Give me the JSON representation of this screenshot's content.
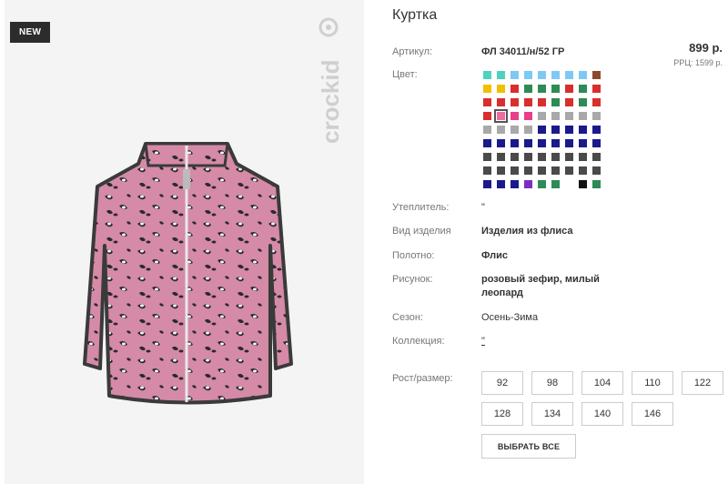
{
  "badge": "NEW",
  "brand": "crockid",
  "product": {
    "title": "Куртка",
    "price": "899 р.",
    "rrp": "РРЦ: 1599 р."
  },
  "labels": {
    "article": "Артикул:",
    "color": "Цвет:",
    "insulation": "Утеплитель:",
    "item_type": "Вид изделия",
    "fabric": "Полотно:",
    "print": "Рисунок:",
    "season": "Сезон:",
    "collection": "Коллекция:",
    "size": "Рост/размер:"
  },
  "values": {
    "article": "ФЛ 34011/н/52 ГР",
    "insulation": "\"",
    "item_type": "Изделия из флиса",
    "fabric": "Флис",
    "print_line1": "розовый зефир, милый",
    "print_line2": "леопард",
    "season": "Осень-Зима",
    "collection": "\""
  },
  "swatches": [
    [
      "#4fd1c1",
      "#4fd1c1",
      "#7fc8f5",
      "#7fc8f5",
      "#7fc8f5",
      "#7fc8f5",
      "#7fc8f5",
      "#7fc8f5",
      "#8b4a2b"
    ],
    [
      "#f0c000",
      "#f0c000",
      "#d92e2e",
      "#2e8b57",
      "#2e8b57",
      "#2e8b57",
      "#d92e2e",
      "#2e8b57",
      "#d92e2e"
    ],
    [
      "#d92e2e",
      "#d92e2e",
      "#d92e2e",
      "#d92e2e",
      "#d92e2e",
      "#2e8b57",
      "#d92e2e",
      "#2e8b57",
      "#d92e2e"
    ],
    [
      "#d92e2e",
      "#f06a9c",
      "#e83e8c",
      "#e83e8c",
      "#a9a9a9",
      "#a9a9a9",
      "#a9a9a9",
      "#a9a9a9",
      "#a9a9a9"
    ],
    [
      "#a9a9a9",
      "#a9a9a9",
      "#a9a9a9",
      "#a9a9a9",
      "#1a1a8c",
      "#1a1a8c",
      "#1a1a8c",
      "#1a1a8c",
      "#1a1a8c"
    ],
    [
      "#1a1a8c",
      "#1a1a8c",
      "#1a1a8c",
      "#1a1a8c",
      "#1a1a8c",
      "#1a1a8c",
      "#1a1a8c",
      "#1a1a8c",
      "#1a1a8c"
    ],
    [
      "#4a4a4a",
      "#4a4a4a",
      "#4a4a4a",
      "#4a4a4a",
      "#4a4a4a",
      "#4a4a4a",
      "#4a4a4a",
      "#4a4a4a",
      "#4a4a4a"
    ],
    [
      "#4a4a4a",
      "#4a4a4a",
      "#4a4a4a",
      "#4a4a4a",
      "#4a4a4a",
      "#4a4a4a",
      "#4a4a4a",
      "#4a4a4a",
      "#4a4a4a"
    ],
    [
      "#1a1a8c",
      "#1a1a8c",
      "#1a1a8c",
      "#7b2fbf",
      "#2e8b57",
      "#2e8b57",
      "#ffffff",
      "#111111",
      "#2e8b57"
    ]
  ],
  "selected_swatch": "3-1",
  "sizes": [
    "92",
    "98",
    "104",
    "110",
    "122",
    "128",
    "134",
    "140",
    "146"
  ],
  "select_all": "ВЫБРАТЬ ВСЕ"
}
